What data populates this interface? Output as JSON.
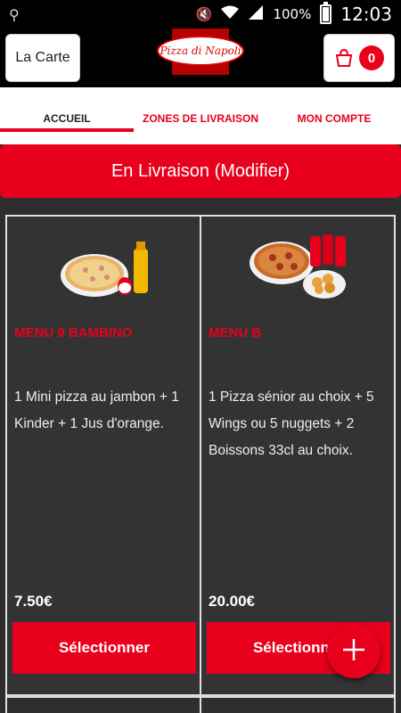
{
  "status_bar": {
    "battery": "100%",
    "time": "12:03",
    "icons": [
      "usb-icon",
      "mute-icon",
      "wifi-icon",
      "signal-icon",
      "battery-icon"
    ]
  },
  "header": {
    "carte_label": "La Carte",
    "logo_text": "Pizza di Napoli",
    "cart_count": "0"
  },
  "tabs": [
    {
      "label": "ACCUEIL",
      "active": true
    },
    {
      "label": "ZONES DE LIVRAISON",
      "active": false
    },
    {
      "label": "MON COMPTE",
      "active": false
    }
  ],
  "delivery_label": "En Livraison (Modifier)",
  "menus": [
    {
      "title": "MENU 9 BAMBINO",
      "description": "1 Mini pizza au jambon  + 1 Kinder  + 1 Jus d'orange.",
      "price": "7.50€",
      "button": "Sélectionner",
      "image": "pizza-kinder-orange-juice-image"
    },
    {
      "title": "MENU B",
      "description": "1 Pizza sénior au choix  + 5 Wings ou 5 nuggets  + 2 Boissons 33cl au choix.",
      "price": "20.00€",
      "button": "Sélectionner",
      "image": "pizza-coke-nuggets-image"
    }
  ],
  "colors": {
    "accent": "#e8001c",
    "card_bg": "#333333",
    "header_bg": "#000000"
  }
}
